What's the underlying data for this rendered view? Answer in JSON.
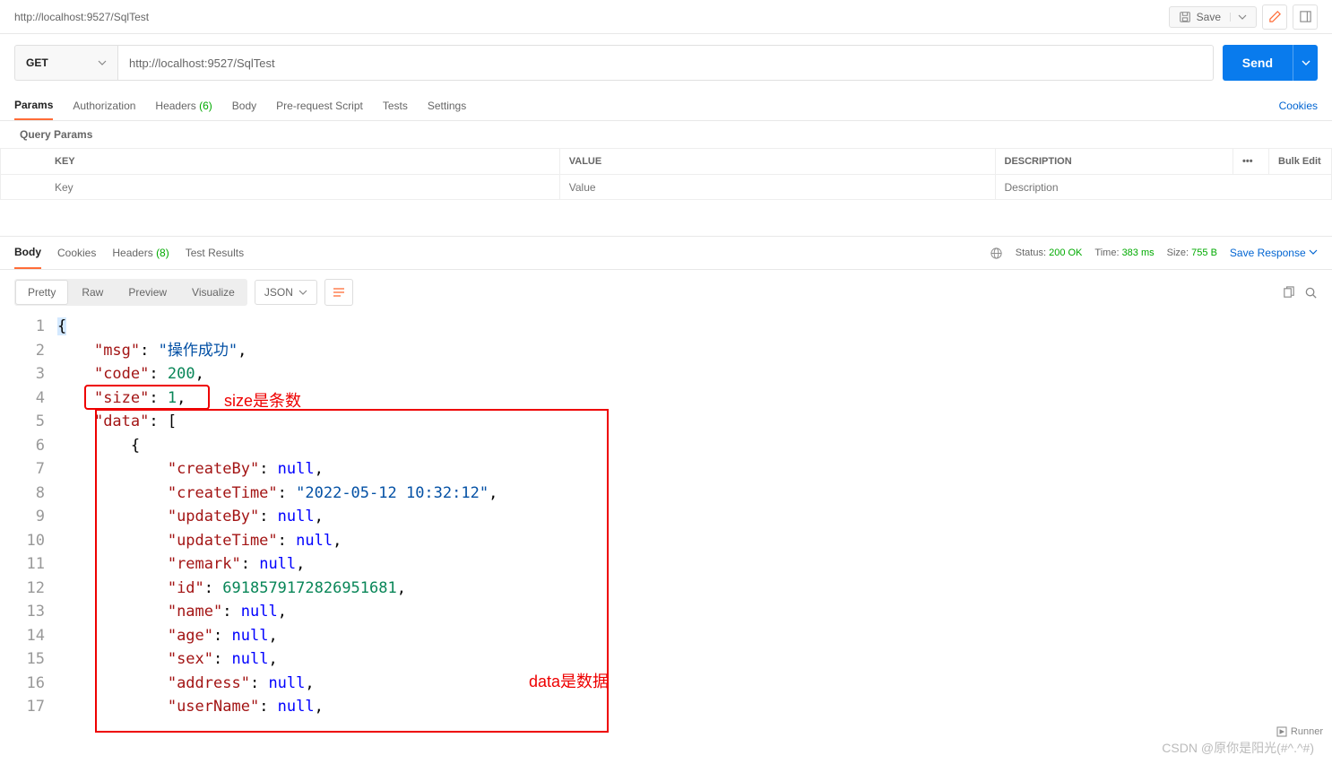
{
  "topbar": {
    "title": "http://localhost:9527/SqlTest",
    "save": "Save"
  },
  "request": {
    "method": "GET",
    "url": "http://localhost:9527/SqlTest",
    "send": "Send"
  },
  "reqTabs": {
    "params": "Params",
    "auth": "Authorization",
    "headers": "Headers",
    "headers_count": "(6)",
    "body": "Body",
    "prereq": "Pre-request Script",
    "tests": "Tests",
    "settings": "Settings",
    "cookies": "Cookies"
  },
  "queryHeader": "Query Params",
  "paramsTable": {
    "key": "KEY",
    "value": "VALUE",
    "desc": "DESCRIPTION",
    "bulk": "Bulk Edit",
    "ph_key": "Key",
    "ph_value": "Value",
    "ph_desc": "Description"
  },
  "respTabs": {
    "body": "Body",
    "cookies": "Cookies",
    "headers": "Headers",
    "headers_count": "(8)",
    "tests": "Test Results"
  },
  "status": {
    "status_l": "Status:",
    "status_v": "200 OK",
    "time_l": "Time:",
    "time_v": "383 ms",
    "size_l": "Size:",
    "size_v": "755 B",
    "save": "Save Response"
  },
  "viewTabs": {
    "pretty": "Pretty",
    "raw": "Raw",
    "preview": "Preview",
    "visualize": "Visualize",
    "format": "JSON"
  },
  "code": {
    "l1": "{",
    "l2_k": "\"msg\"",
    "l2_v": "\"操作成功\"",
    "l3_k": "\"code\"",
    "l3_v": "200",
    "l4_k": "\"size\"",
    "l4_v": "1",
    "l5_k": "\"data\"",
    "l7_k": "\"createBy\"",
    "l8_k": "\"createTime\"",
    "l8_v": "\"2022-05-12 10:32:12\"",
    "l9_k": "\"updateBy\"",
    "l10_k": "\"updateTime\"",
    "l11_k": "\"remark\"",
    "l12_k": "\"id\"",
    "l12_v": "6918579172826951681",
    "l13_k": "\"name\"",
    "l14_k": "\"age\"",
    "l15_k": "\"sex\"",
    "l16_k": "\"address\"",
    "l17_k": "\"userName\"",
    "null": "null"
  },
  "lineNums": [
    "1",
    "2",
    "3",
    "4",
    "5",
    "6",
    "7",
    "8",
    "9",
    "10",
    "11",
    "12",
    "13",
    "14",
    "15",
    "16",
    "17"
  ],
  "annot": {
    "size": "size是条数",
    "data": "data是数据"
  },
  "watermark": "CSDN @原你是阳光(#^.^#)",
  "runner": "Runner"
}
